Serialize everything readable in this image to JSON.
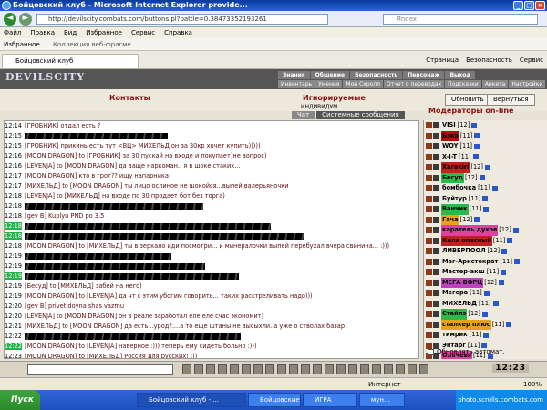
{
  "window": {
    "title": "Бойцовский клуб - Microsoft Internet Explorer provide...",
    "url": "http://devilscity.combats.com/buttons.pl?battle=0.38473352193261",
    "search_placeholder": "Яndex"
  },
  "menu": [
    "Файл",
    "Правка",
    "Вид",
    "Избранное",
    "Сервис",
    "Справка"
  ],
  "favorites": {
    "label": "Избранное",
    "collection": "Коллекция веб-фрагме..."
  },
  "browser_tab": {
    "label": "Бойцовский клуб"
  },
  "tab_tools": [
    "Страница",
    "Безопасность",
    "Сервис"
  ],
  "game": {
    "logo": "DEVILSCITY",
    "nav_top": [
      "Знания",
      "Общение",
      "Безопасность",
      "Персонаж",
      "Выход"
    ],
    "nav_bottom": [
      "Инвентарь",
      "Умения",
      "Мой Скролл",
      "Отчет о переводах",
      "Подсказки",
      "Анкета",
      "Настройки"
    ],
    "contacts": "Контакты",
    "ignored": "Игнорируемые",
    "individual_label": "ИНДИВИДУМ",
    "refresh_button": "Обновить",
    "back_button": "Вернуться",
    "chat_tabs": [
      "Чат",
      "Системные сообщения"
    ],
    "moderators_title": "Модераторы on-line",
    "auto_update": "Обновлять автомат."
  },
  "chat": [
    {
      "time": "12:14",
      "hl": false,
      "text": "[ГРОБНИК] отдал есть ?"
    },
    {
      "time": "12:15",
      "hl": false,
      "text": ""
    },
    {
      "time": "12:15",
      "hl": false,
      "text": "[ГРОБНИК] прикинь есть тут <ВЦ> МИХЕЛЬД он за 30кр хочет купить)))))"
    },
    {
      "time": "12:16",
      "hl": false,
      "text": "[MOON DRAGON] to [ГРОБНИК] за 30 пускай на входе и покупает)не вопрос)"
    },
    {
      "time": "12:16",
      "hl": false,
      "text": "[LEVENJA] to [MOON DRAGON] да ваще наркоман.. я в шоке стаких..."
    },
    {
      "time": "12:17",
      "hl": false,
      "text": "[MOON DRAGON] кто в грот?? ищу напарника!"
    },
    {
      "time": "12:17",
      "hl": false,
      "text": "[МИХЕЛЬД] to [MOON DRAGON] ты лицо ослиное не шокойся...выпей валерьяночки"
    },
    {
      "time": "12:18",
      "hl": false,
      "text": "[LEVENJA] to [МИХЕЛЬД] на входе по 30 продает бот без торга)"
    },
    {
      "time": "12:18",
      "hl": false,
      "text": ""
    },
    {
      "time": "12:18",
      "hl": false,
      "text": "[gev B] Kuplyu PND po 3.5"
    },
    {
      "time": "12:18",
      "hl": true,
      "text": ""
    },
    {
      "time": "12:18",
      "hl": true,
      "text": ""
    },
    {
      "time": "12:18",
      "hl": false,
      "text": "[MOON DRAGON] to [МИХЕЛЬД] ты в зеркало иди посмотри... и минералочки выпей перебухал вчера свинина... :)))"
    },
    {
      "time": "12:19",
      "hl": false,
      "text": ""
    },
    {
      "time": "12:19",
      "hl": false,
      "text": ""
    },
    {
      "time": "12:19",
      "hl": true,
      "text": ""
    },
    {
      "time": "12:19",
      "hl": false,
      "text": "[Бесуд] to [МИХЕЛЬД] забей на него)"
    },
    {
      "time": "12:19",
      "hl": false,
      "text": "[MOON DRAGON] to [LEVENJA] да чт с этим убогим говорить... таких расстреливать надо)))"
    },
    {
      "time": "12:20",
      "hl": false,
      "text": "[gev B] privet doyna shas vazmu"
    },
    {
      "time": "12:20",
      "hl": false,
      "text": "[LEVENJA] to [MOON DRAGON] он в реале заработал еле еле счас экономит)"
    },
    {
      "time": "12:21",
      "hl": false,
      "text": "[МИХЕЛЬД] to [MOON DRAGON] да есть ..урод?....а то ещё штаны не высыхли..а уже о стволах базар"
    },
    {
      "time": "12:22",
      "hl": false,
      "text": ""
    },
    {
      "time": "12:22",
      "hl": true,
      "text": "[MOON DRAGON] to [LEVENJA] наверное :))) теперь ему сидеть больно :)))"
    },
    {
      "time": "12:23",
      "hl": false,
      "text": "[MOON DRAGON] to [МИХЕЛЬД] Россия для русских! :))"
    }
  ],
  "online_users": [
    {
      "name": "VISI",
      "level": "[12]",
      "bg": "none"
    },
    {
      "name": "Бэка",
      "level": "[11]",
      "bg": "#b01010"
    },
    {
      "name": "WOY",
      "level": "[11]",
      "bg": "none"
    },
    {
      "name": "X-I-T",
      "level": "[11]",
      "bg": "none"
    },
    {
      "name": "Xarakiri",
      "level": "[12]",
      "bg": "#c02020"
    },
    {
      "name": "Бесуд",
      "level": "[12]",
      "bg": "#2fb84a"
    },
    {
      "name": "бомбочка",
      "level": "[11]",
      "bg": "none"
    },
    {
      "name": "Буйтур",
      "level": "[11]",
      "bg": "none"
    },
    {
      "name": "Ванчик",
      "level": "[11]",
      "bg": "#2fb84a"
    },
    {
      "name": "Гача",
      "level": "[12]",
      "bg": "#e8a020"
    },
    {
      "name": "каратель духов",
      "level": "[12]",
      "bg": "#e040a0"
    },
    {
      "name": "Коля опасный",
      "level": "[11]",
      "bg": "#c02020"
    },
    {
      "name": "ЛИВЕРПООЛ",
      "level": "[12]",
      "bg": "none"
    },
    {
      "name": "Маг-Аристократ",
      "level": "[11]",
      "bg": "none"
    },
    {
      "name": "Мастер-акш",
      "level": "[11]",
      "bg": "none"
    },
    {
      "name": "МЕГА ВОРЦ",
      "level": "[12]",
      "bg": "#c040c0"
    },
    {
      "name": "Мегера",
      "level": "[11]",
      "bg": "none"
    },
    {
      "name": "МИХЕЛЬД",
      "level": "[11]",
      "bg": "none"
    },
    {
      "name": "Стайлз",
      "level": "[12]",
      "bg": "#2fb84a"
    },
    {
      "name": "сталкер плюс",
      "level": "[11]",
      "bg": "#e8a020"
    },
    {
      "name": "тимрик",
      "level": "[11]",
      "bg": "none"
    },
    {
      "name": "Энтарг",
      "level": "[11]",
      "bg": "none"
    },
    {
      "name": "Ольчевя",
      "level": "[11]",
      "bg": "#e040a0"
    }
  ],
  "clock": "12:23",
  "status": {
    "zone": "Интернет",
    "zoom": "100%"
  },
  "taskbar": {
    "start": "Пуск",
    "tasks": [
      "Бойцовский клуб - ...",
      "Бойцовские дневник...",
      "ИГРА",
      "мун..."
    ],
    "tray_text": "photo.scrolls.combats.com"
  },
  "colors": {
    "chat_time_highlight": "#21b24a",
    "title_red": "#8b1111"
  }
}
